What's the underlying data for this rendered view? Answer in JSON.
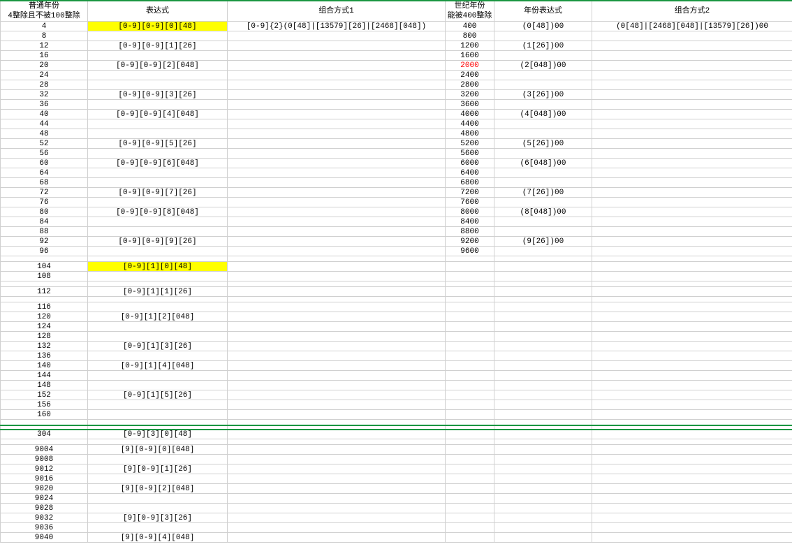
{
  "headers": {
    "h1": "普通年份\n4整除且不被100整除",
    "h2": "表达式",
    "h3": "组合方式1",
    "h4": "世纪年份\n能被400整除",
    "h5": "年份表达式",
    "h6": "组合方式2"
  },
  "combo1": "[0-9]{2}(0[48]|[13579][26]|[2468][048])",
  "combo2": "(0[48]|[2468][048]|[13579][26])00",
  "sec1": [
    {
      "a": "4",
      "b": "[0-9][0-9][0][48]",
      "b_hl": true,
      "c": "400",
      "c_red": false,
      "d": "(0[48])00"
    },
    {
      "a": "8",
      "b": "",
      "c": "800",
      "d": ""
    },
    {
      "a": "12",
      "b": "[0-9][0-9][1][26]",
      "c": "1200",
      "d": "(1[26])00"
    },
    {
      "a": "16",
      "b": "",
      "c": "1600",
      "d": ""
    },
    {
      "a": "20",
      "b": "[0-9][0-9][2][048]",
      "c": "2000",
      "c_red": true,
      "d": "(2[048])00"
    },
    {
      "a": "24",
      "b": "",
      "c": "2400",
      "d": ""
    },
    {
      "a": "28",
      "b": "",
      "c": "2800",
      "d": ""
    },
    {
      "a": "32",
      "b": "[0-9][0-9][3][26]",
      "c": "3200",
      "d": "(3[26])00"
    },
    {
      "a": "36",
      "b": "",
      "c": "3600",
      "d": ""
    },
    {
      "a": "40",
      "b": "[0-9][0-9][4][048]",
      "c": "4000",
      "d": "(4[048])00"
    },
    {
      "a": "44",
      "b": "",
      "c": "4400",
      "d": ""
    },
    {
      "a": "48",
      "b": "",
      "c": "4800",
      "d": ""
    },
    {
      "a": "52",
      "b": "[0-9][0-9][5][26]",
      "c": "5200",
      "d": "(5[26])00"
    },
    {
      "a": "56",
      "b": "",
      "c": "5600",
      "d": ""
    },
    {
      "a": "60",
      "b": "[0-9][0-9][6][048]",
      "c": "6000",
      "d": "(6[048])00"
    },
    {
      "a": "64",
      "b": "",
      "c": "6400",
      "d": ""
    },
    {
      "a": "68",
      "b": "",
      "c": "6800",
      "d": ""
    },
    {
      "a": "72",
      "b": "[0-9][0-9][7][26]",
      "c": "7200",
      "d": "(7[26])00"
    },
    {
      "a": "76",
      "b": "",
      "c": "7600",
      "d": ""
    },
    {
      "a": "80",
      "b": "[0-9][0-9][8][048]",
      "c": "8000",
      "d": "(8[048])00"
    },
    {
      "a": "84",
      "b": "",
      "c": "8400",
      "d": ""
    },
    {
      "a": "88",
      "b": "",
      "c": "8800",
      "d": ""
    },
    {
      "a": "92",
      "b": "[0-9][0-9][9][26]",
      "c": "9200",
      "d": "(9[26])00"
    },
    {
      "a": "96",
      "b": "",
      "c": "9600",
      "d": ""
    }
  ],
  "sec2": [
    {
      "a": "104",
      "b": "[0-9][1][0][48]",
      "b_hl": true
    },
    {
      "a": "108",
      "b": ""
    },
    {
      "a": "",
      "b": "",
      "spacer": true
    },
    {
      "a": "112",
      "b": "[0-9][1][1][26]"
    },
    {
      "a": "",
      "b": "",
      "spacer": true
    },
    {
      "a": "116",
      "b": ""
    },
    {
      "a": "120",
      "b": "[0-9][1][2][048]"
    },
    {
      "a": "124",
      "b": ""
    },
    {
      "a": "128",
      "b": ""
    },
    {
      "a": "132",
      "b": "[0-9][1][3][26]"
    },
    {
      "a": "136",
      "b": ""
    },
    {
      "a": "140",
      "b": "[0-9][1][4][048]"
    },
    {
      "a": "144",
      "b": ""
    },
    {
      "a": "148",
      "b": ""
    },
    {
      "a": "152",
      "b": "[0-9][1][5][26]"
    },
    {
      "a": "156",
      "b": ""
    },
    {
      "a": "160",
      "b": ""
    }
  ],
  "sec3": [
    {
      "a": "304",
      "b": "[0-9][3][0][48]"
    }
  ],
  "sec4": [
    {
      "a": "9004",
      "b": "[9][0-9][0][048]"
    },
    {
      "a": "9008",
      "b": ""
    },
    {
      "a": "9012",
      "b": "[9][0-9][1][26]"
    },
    {
      "a": "9016",
      "b": ""
    },
    {
      "a": "9020",
      "b": "[9][0-9][2][048]"
    },
    {
      "a": "9024",
      "b": ""
    },
    {
      "a": "9028",
      "b": ""
    },
    {
      "a": "9032",
      "b": "[9][0-9][3][26]"
    },
    {
      "a": "9036",
      "b": ""
    },
    {
      "a": "9040",
      "b": "[9][0-9][4][048]"
    }
  ]
}
